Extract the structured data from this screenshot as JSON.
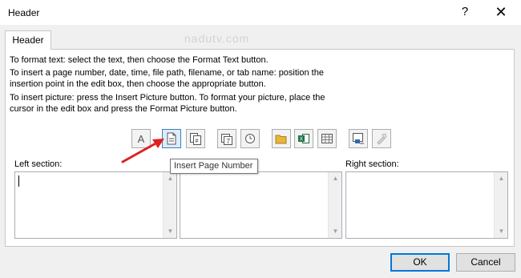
{
  "window": {
    "title": "Header",
    "help_glyph": "?",
    "close_glyph": "✕"
  },
  "tab": {
    "label": "Header"
  },
  "watermark": "nadutv.com",
  "instructions": [
    "To format text:  select the text, then choose the Format Text button.",
    "To insert a page number, date, time, file path, filename, or tab name:  position the",
    "insertion point in the edit box, then choose the appropriate button.",
    "To insert picture: press the Insert Picture button.  To format your picture, place the",
    "cursor in the edit box and press the Format Picture button."
  ],
  "toolbar": {
    "format_text_glyph": "A",
    "buttons": [
      "format-text",
      "insert-page-number",
      "insert-number-of-pages",
      "insert-date",
      "insert-time",
      "insert-file-path",
      "insert-file-name",
      "insert-sheet-name",
      "insert-picture",
      "format-picture"
    ]
  },
  "tooltip": {
    "text": "Insert Page Number"
  },
  "sections": {
    "left": {
      "label": "Left section:",
      "value": ""
    },
    "center": {
      "label": "",
      "value": ""
    },
    "right": {
      "label": "Right section:",
      "value": ""
    }
  },
  "buttons": {
    "ok": "OK",
    "cancel": "Cancel"
  },
  "colors": {
    "accent": "#0078d7",
    "arrow": "#e02020",
    "excel_green": "#1e7145",
    "folder_yellow": "#e8b43a"
  }
}
